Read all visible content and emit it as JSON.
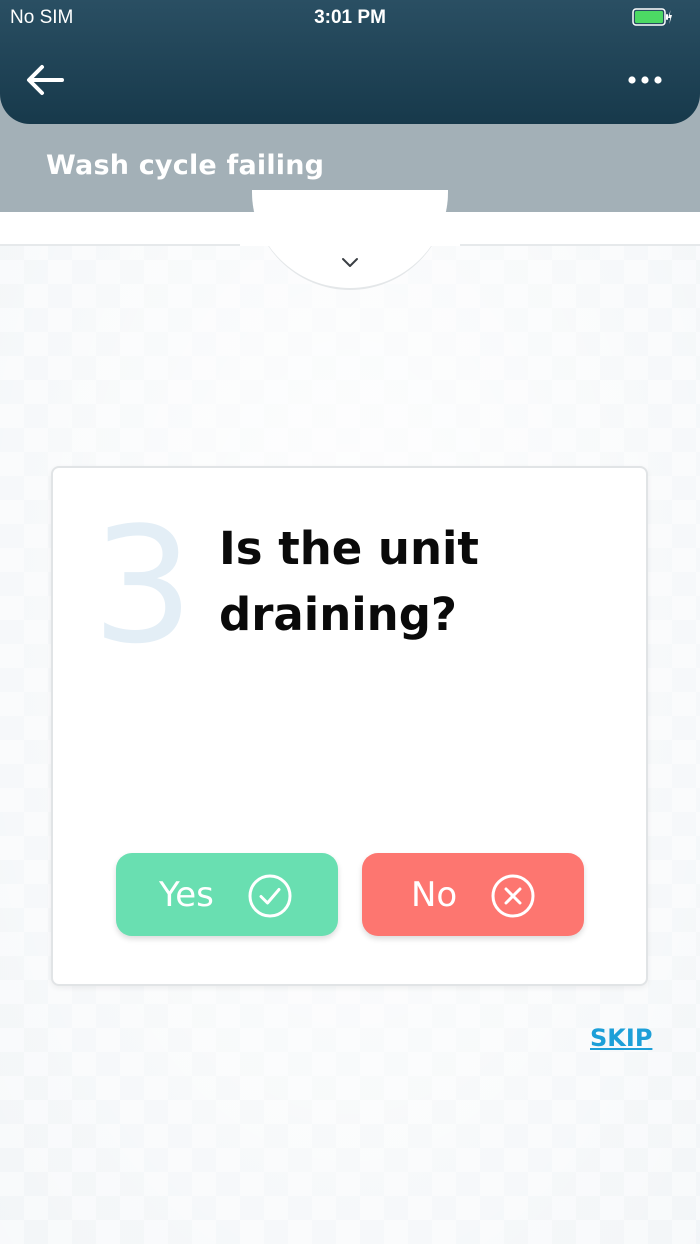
{
  "status_bar": {
    "carrier": "No SIM",
    "time": "3:01 PM",
    "battery_icon": "battery-charging-icon",
    "battery_color": "#4cd964"
  },
  "nav": {
    "back_icon": "arrow-left-icon",
    "more_icon": "more-horizontal-icon",
    "background_color": "#1d4256"
  },
  "subheader": {
    "title": "Wash cycle failing"
  },
  "expander": {
    "icon": "chevron-down-icon"
  },
  "question_card": {
    "step_number": "3",
    "question": "Is the unit draining?",
    "yes_label": "Yes",
    "yes_icon": "check-circle-icon",
    "yes_color": "#69dfb1",
    "no_label": "No",
    "no_icon": "x-circle-icon",
    "no_color": "#fd7670"
  },
  "skip_label": "SKIP",
  "colors": {
    "accent_link": "#1d9fd8",
    "subheader_bg": "#a3b0b7"
  }
}
